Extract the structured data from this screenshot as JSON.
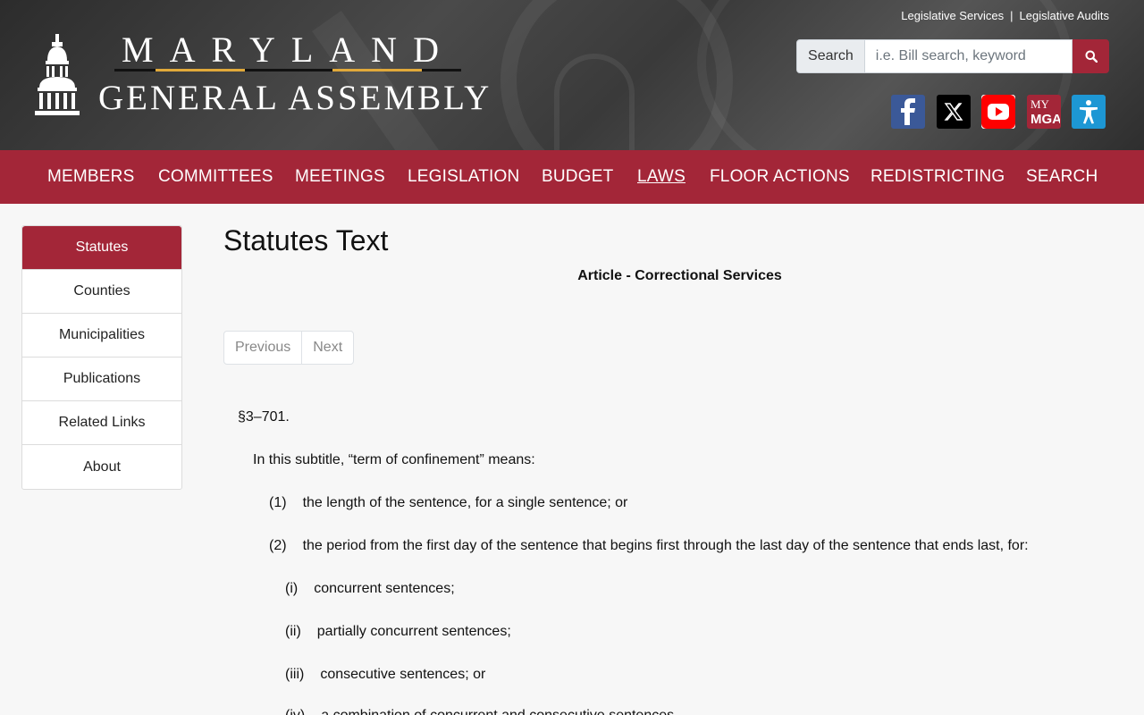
{
  "header": {
    "logo_top": "MARYLAND",
    "logo_bottom": "GENERAL ASSEMBLY",
    "top_links": [
      "Legislative Services",
      "Legislative Audits"
    ],
    "separator": "|",
    "search": {
      "label": "Search",
      "placeholder": "i.e. Bill search, keyword"
    },
    "social": {
      "my_label": "MY",
      "mga_label": "MGA"
    }
  },
  "nav": {
    "items": [
      "MEMBERS",
      "COMMITTEES",
      "MEETINGS",
      "LEGISLATION",
      "BUDGET",
      "LAWS",
      "FLOOR ACTIONS",
      "REDISTRICTING",
      "SEARCH"
    ],
    "active": "LAWS"
  },
  "sidebar": {
    "items": [
      "Statutes",
      "Counties",
      "Municipalities",
      "Publications",
      "Related Links",
      "About"
    ],
    "active": "Statutes"
  },
  "main": {
    "title": "Statutes Text",
    "article": "Article - Correctional Services",
    "pager": {
      "previous": "Previous",
      "next": "Next"
    },
    "section": "§3–701.",
    "intro": "In this subtitle, “term of confinement” means:",
    "items": [
      {
        "num": "(1)",
        "text": "the length of the sentence, for a single sentence; or"
      },
      {
        "num": "(2)",
        "text": "the period from the first day of the sentence that begins first through the last day of the sentence that ends last, for:"
      },
      {
        "num": "(i)",
        "text": "concurrent sentences;"
      },
      {
        "num": "(ii)",
        "text": "partially concurrent sentences;"
      },
      {
        "num": "(iii)",
        "text": "consecutive sentences; or"
      },
      {
        "num": "(iv)",
        "text": "a combination of concurrent and consecutive sentences."
      }
    ]
  },
  "colors": {
    "brand": "#a32638",
    "gold": "#e1a93a"
  }
}
